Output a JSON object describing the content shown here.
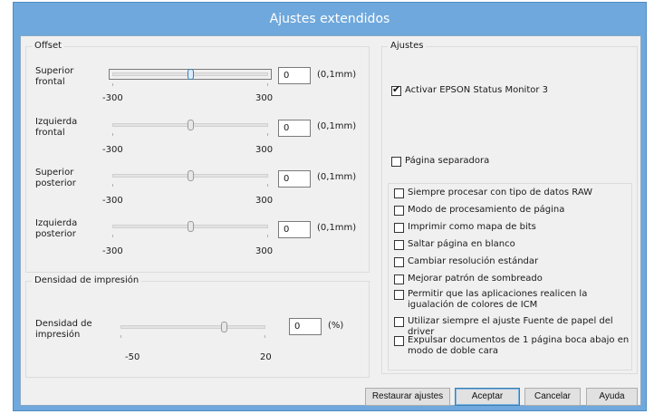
{
  "window": {
    "title": "Ajustes extendidos"
  },
  "offset": {
    "title": "Offset",
    "rows": [
      {
        "label": "Superior frontal",
        "value": "0",
        "unit": "(0,1mm)",
        "min": "-300",
        "max": "300",
        "position": 0.5
      },
      {
        "label": "Izquierda frontal",
        "value": "0",
        "unit": "(0,1mm)",
        "min": "-300",
        "max": "300",
        "position": 0.5
      },
      {
        "label": "Superior posterior",
        "value": "0",
        "unit": "(0,1mm)",
        "min": "-300",
        "max": "300",
        "position": 0.5
      },
      {
        "label": "Izquierda posterior",
        "value": "0",
        "unit": "(0,1mm)",
        "min": "-300",
        "max": "300",
        "position": 0.5
      }
    ]
  },
  "density": {
    "title": "Densidad de impresión",
    "label": "Densidad de impresión",
    "value": "0",
    "unit": "(%)",
    "min": "-50",
    "max": "20",
    "position": 0.714
  },
  "settings": {
    "title": "Ajustes",
    "status_monitor": {
      "label": "Activar EPSON Status Monitor 3",
      "checked": true
    },
    "separator_page": {
      "label": "Página separadora",
      "checked": false
    },
    "options": [
      {
        "label": "Siempre procesar con tipo de datos RAW",
        "checked": false
      },
      {
        "label": "Modo de procesamiento de página",
        "checked": false
      },
      {
        "label": "Imprimir como mapa de bits",
        "checked": false
      },
      {
        "label": "Saltar página en blanco",
        "checked": false
      },
      {
        "label": "Cambiar resolución estándar",
        "checked": false
      },
      {
        "label": "Mejorar patrón de sombreado",
        "checked": false
      },
      {
        "label": "Permitir que las aplicaciones realicen la igualación de colores de ICM",
        "checked": false
      },
      {
        "label": "Utilizar siempre el ajuste Fuente de papel del driver",
        "checked": false
      },
      {
        "label": "Expulsar documentos de 1 página boca abajo en modo de doble cara",
        "checked": false
      }
    ]
  },
  "buttons": {
    "restore": "Restaurar ajustes",
    "ok": "Aceptar",
    "cancel": "Cancelar",
    "help": "Ayuda"
  }
}
